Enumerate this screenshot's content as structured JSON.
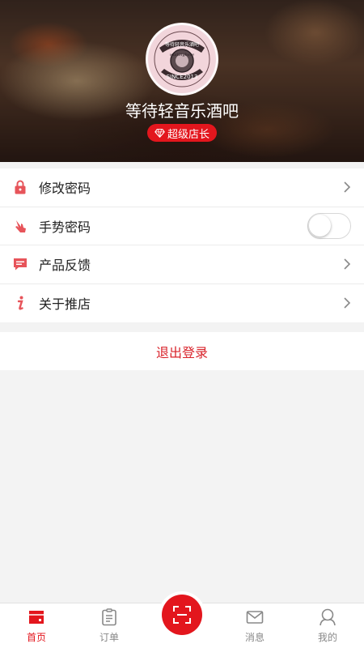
{
  "profile": {
    "store_name": "等待轻音乐酒吧",
    "badge_label": "超级店长",
    "avatar_icon": "bar-logo-seal",
    "avatar_logo_text": {
      "top": "等待轻音乐酒吧",
      "middle": "waitinghere",
      "bottom": "SINCE2013"
    }
  },
  "menu": {
    "items": [
      {
        "label": "修改密码",
        "icon": "lock-icon",
        "control": "chevron"
      },
      {
        "label": "手势密码",
        "icon": "gesture-hand-icon",
        "control": "toggle",
        "toggle_on": false
      },
      {
        "label": "产品反馈",
        "icon": "feedback-chat-icon",
        "control": "chevron"
      },
      {
        "label": "关于推店",
        "icon": "info-icon",
        "control": "chevron"
      }
    ]
  },
  "logout_label": "退出登录",
  "tabbar": {
    "tabs": [
      {
        "label": "首页",
        "icon": "shop-icon",
        "active": true
      },
      {
        "label": "订单",
        "icon": "clipboard-icon",
        "active": false
      },
      {
        "label": "",
        "icon": "scan-icon",
        "active": false
      },
      {
        "label": "消息",
        "icon": "mail-icon",
        "active": false
      },
      {
        "label": "我的",
        "icon": "user-icon",
        "active": false
      }
    ]
  },
  "colors": {
    "accent": "#e3161d",
    "menu_icon": "#e7545a",
    "logout_text": "#d9232b",
    "page_bg": "#f3f3f3"
  }
}
